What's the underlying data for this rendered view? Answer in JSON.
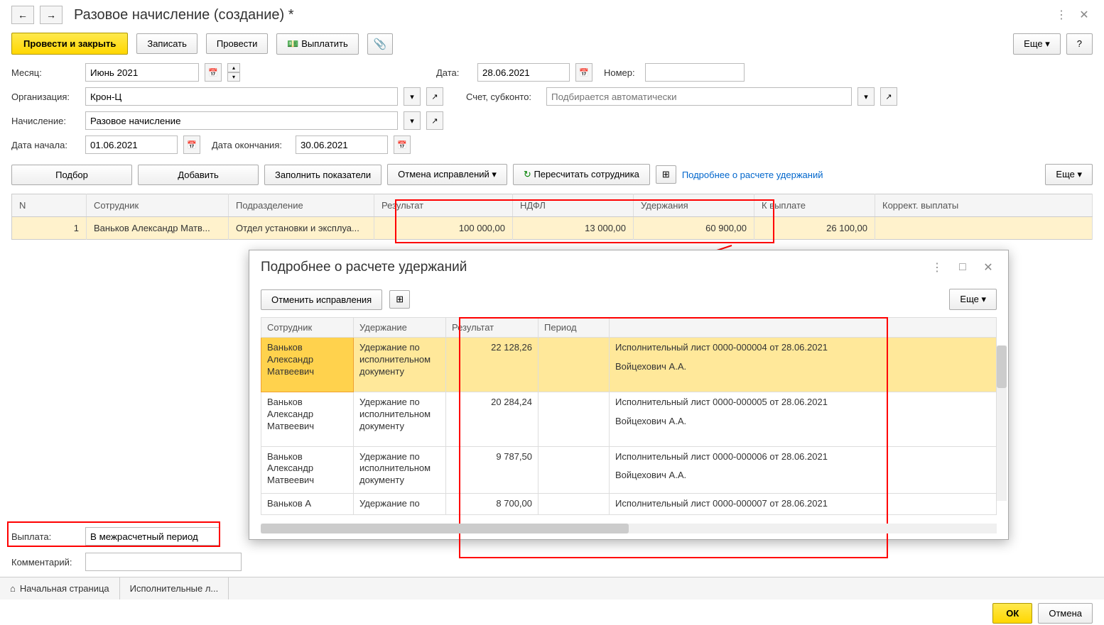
{
  "header": {
    "title": "Разовое начисление (создание) *"
  },
  "toolbar": {
    "post_close": "Провести и закрыть",
    "write": "Записать",
    "post": "Провести",
    "pay": "Выплатить",
    "more": "Еще",
    "help": "?"
  },
  "form": {
    "month_label": "Месяц:",
    "month": "Июнь 2021",
    "date_label": "Дата:",
    "date": "28.06.2021",
    "number_label": "Номер:",
    "number": "",
    "org_label": "Организация:",
    "org": "Крон-Ц",
    "account_label": "Счет, субконто:",
    "account_placeholder": "Подбирается автоматически",
    "accrual_label": "Начисление:",
    "accrual": "Разовое начисление",
    "start_label": "Дата начала:",
    "start": "01.06.2021",
    "end_label": "Дата окончания:",
    "end": "30.06.2021"
  },
  "table_toolbar": {
    "select": "Подбор",
    "add": "Добавить",
    "fill": "Заполнить показатели",
    "undo": "Отмена исправлений",
    "recalc": "Пересчитать сотрудника",
    "details_link": "Подробнее о расчете удержаний",
    "more": "Еще"
  },
  "main_table": {
    "headers": {
      "n": "N",
      "employee": "Сотрудник",
      "dept": "Подразделение",
      "result": "Результат",
      "ndfl": "НДФЛ",
      "deductions": "Удержания",
      "payable": "К выплате",
      "correct": "Коррект. выплаты"
    },
    "rows": [
      {
        "n": "1",
        "employee": "Ваньков Александр Матв...",
        "dept": "Отдел установки и эксплуа...",
        "result": "100 000,00",
        "ndfl": "13 000,00",
        "deductions": "60 900,00",
        "payable": "26 100,00",
        "correct": ""
      }
    ]
  },
  "popup": {
    "title": "Подробнее о расчете удержаний",
    "undo": "Отменить исправления",
    "more": "Еще",
    "headers": {
      "employee": "Сотрудник",
      "deduction": "Удержание",
      "result": "Результат",
      "period": "Период",
      "desc": ""
    },
    "rows": [
      {
        "employee": "Ваньков Александр Матвеевич",
        "deduction": "Удержание по исполнительном документу",
        "result": "22 128,26",
        "period": "",
        "desc1": "Исполнительный лист 0000-000004 от 28.06.2021",
        "desc2": "Войцехович А.А."
      },
      {
        "employee": "Ваньков Александр Матвеевич",
        "deduction": "Удержание по исполнительном документу",
        "result": "20 284,24",
        "period": "",
        "desc1": "Исполнительный лист 0000-000005 от 28.06.2021",
        "desc2": "Войцехович А.А."
      },
      {
        "employee": "Ваньков Александр Матвеевич",
        "deduction": "Удержание по исполнительном документу",
        "result": "9 787,50",
        "period": "",
        "desc1": "Исполнительный лист 0000-000006 от 28.06.2021",
        "desc2": "Войцехович А.А."
      },
      {
        "employee": "Ваньков А",
        "deduction": "Удержание по",
        "result": "8 700,00",
        "period": "",
        "desc1": "Исполнительный лист 0000-000007 от 28.06.2021",
        "desc2": ""
      }
    ]
  },
  "footer": {
    "payout_label": "Выплата:",
    "payout": "В межрасчетный период",
    "comment_label": "Комментарий:",
    "comment": ""
  },
  "tabs": {
    "home": "Начальная страница",
    "exec": "Исполнительные л..."
  },
  "bottom": {
    "ok": "ОК",
    "cancel": "Отмена"
  }
}
